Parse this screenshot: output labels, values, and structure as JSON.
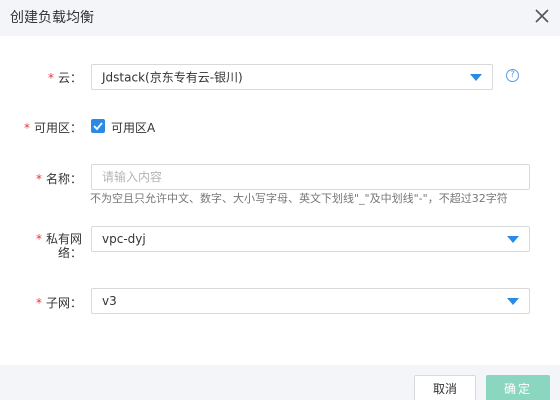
{
  "dialog": {
    "title": "创建负载均衡"
  },
  "form": {
    "cloud": {
      "label": "云：",
      "value": "Jdstack(京东专有云-银川)",
      "help": "?"
    },
    "zone": {
      "label": "可用区：",
      "option_label": "可用区A",
      "checked": true
    },
    "name": {
      "label": "名称：",
      "placeholder": "请输入内容",
      "value": "",
      "hint": "不为空且只允许中文、数字、大小写字母、英文下划线\"_\"及中划线\"-\"，不超过32字符"
    },
    "vpc": {
      "label_line1": "私有网",
      "label_line2": "络：",
      "value": "vpc-dyj"
    },
    "subnet": {
      "label": "子网：",
      "value": "v3"
    },
    "required_mark": "*"
  },
  "footer": {
    "cancel_label": "取消",
    "ok_label": "确定"
  },
  "colors": {
    "accent": "#2b8ae6",
    "required": "#e4393c",
    "ok_button": "#8bd6bf",
    "header_bg": "#f3f5f9"
  }
}
